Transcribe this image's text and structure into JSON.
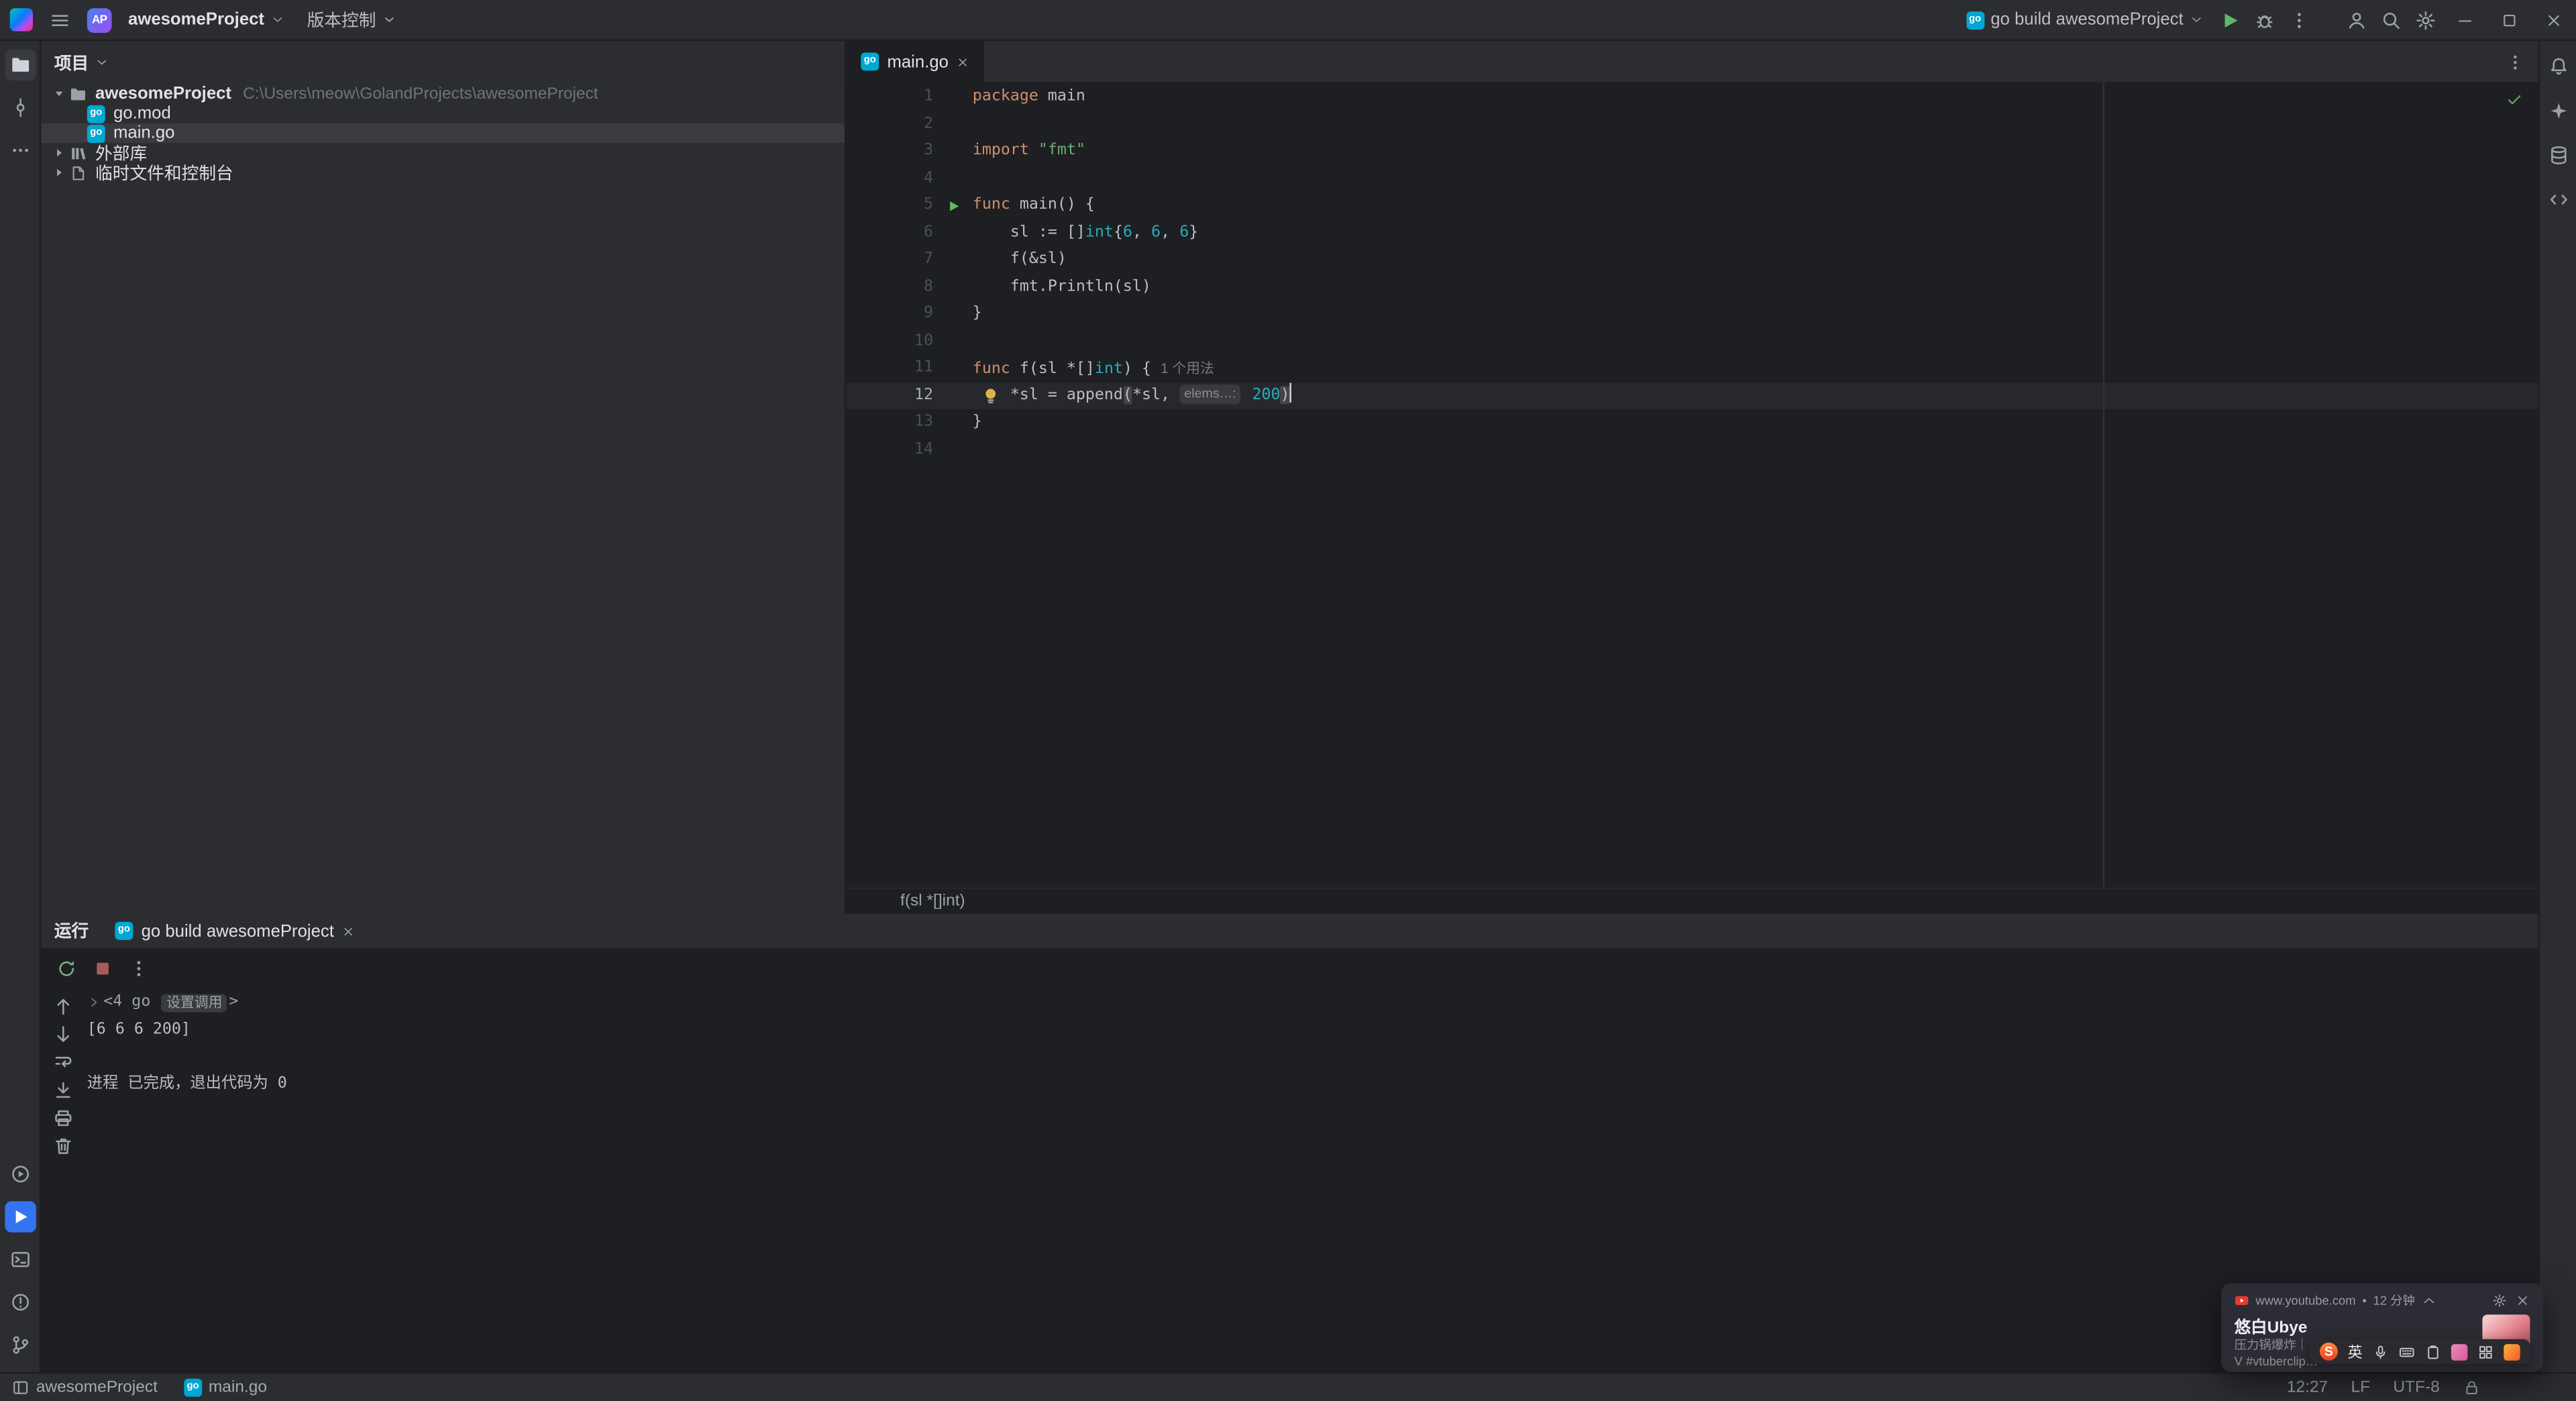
{
  "colors": {
    "accent": "#3574f0",
    "run_green": "#5fb865",
    "keyword": "#cf8e6d",
    "string": "#6aab73",
    "number": "#2aacb8",
    "editor_bg": "#1e1f22",
    "panel_bg": "#2b2d30"
  },
  "icons": {
    "go_badge": "go"
  },
  "titlebar": {
    "project_badge": "AP",
    "project_name": "awesomeProject",
    "vcs_label": "版本控制",
    "run_config_label": "go build awesomeProject"
  },
  "left_strip": {
    "top": [
      {
        "icon": "project-folder-icon",
        "active": true
      },
      {
        "icon": "commit-icon"
      },
      {
        "icon": "more-horizontal-icon"
      }
    ],
    "bottom": [
      {
        "icon": "services-icon"
      },
      {
        "icon": "run-tool-icon",
        "active": true,
        "accent": true
      },
      {
        "icon": "terminal-icon"
      },
      {
        "icon": "problems-icon"
      },
      {
        "icon": "git-branch-icon"
      }
    ]
  },
  "right_strip": {
    "icons": [
      "notifications-bell-icon",
      "ai-assistant-icon",
      "database-icon",
      "endpoints-icon"
    ]
  },
  "project": {
    "header": "项目",
    "items": [
      {
        "name": "awesomeProject",
        "path": "C:\\Users\\meow\\GolandProjects\\awesomeProject",
        "icon": "folder-icon",
        "level": 0,
        "expanded": true,
        "bold": true
      },
      {
        "name": "go.mod",
        "icon": "go-file-icon",
        "level": 1
      },
      {
        "name": "main.go",
        "icon": "go-file-icon",
        "level": 1,
        "selected": true
      },
      {
        "name": "外部库",
        "icon": "library-icon",
        "level": 0,
        "collapsed": true
      },
      {
        "name": "临时文件和控制台",
        "icon": "scratch-icon",
        "level": 0,
        "collapsed": true
      }
    ]
  },
  "editor": {
    "tab_title": "main.go",
    "breadcrumb": "f(sl *[]int)",
    "current_line": 12,
    "run_line": 5,
    "bulb_line": 12,
    "lines": [
      {
        "n": 1,
        "tokens": [
          [
            "kw",
            "package"
          ],
          [
            "pl",
            " main"
          ]
        ]
      },
      {
        "n": 2,
        "tokens": []
      },
      {
        "n": 3,
        "tokens": [
          [
            "kw",
            "import"
          ],
          [
            "pl",
            " "
          ],
          [
            "str",
            "\"fmt\""
          ]
        ]
      },
      {
        "n": 4,
        "tokens": []
      },
      {
        "n": 5,
        "tokens": [
          [
            "kw",
            "func"
          ],
          [
            "pl",
            " main() {"
          ]
        ]
      },
      {
        "n": 6,
        "tokens": [
          [
            "pl",
            "    sl := []"
          ],
          [
            "ty",
            "int"
          ],
          [
            "pl",
            "{"
          ],
          [
            "num",
            "6"
          ],
          [
            "pl",
            ", "
          ],
          [
            "num",
            "6"
          ],
          [
            "pl",
            ", "
          ],
          [
            "num",
            "6"
          ],
          [
            "pl",
            "}"
          ]
        ]
      },
      {
        "n": 7,
        "tokens": [
          [
            "pl",
            "    f(&sl)"
          ]
        ]
      },
      {
        "n": 8,
        "tokens": [
          [
            "pl",
            "    fmt.Println(sl)"
          ]
        ]
      },
      {
        "n": 9,
        "tokens": [
          [
            "pl",
            "}"
          ]
        ]
      },
      {
        "n": 10,
        "tokens": []
      },
      {
        "n": 11,
        "tokens": [
          [
            "kw",
            "func"
          ],
          [
            "pl",
            " f(sl *[]"
          ],
          [
            "ty",
            "int"
          ],
          [
            "pl",
            ") { "
          ],
          [
            "usage",
            "1 个用法"
          ]
        ]
      },
      {
        "n": 12,
        "tokens": [
          [
            "pl",
            "    *sl = append"
          ],
          [
            "brace",
            "("
          ],
          [
            "pl",
            "*sl, "
          ],
          [
            "chip",
            "elems…:"
          ],
          [
            "pl",
            " "
          ],
          [
            "num",
            "200"
          ],
          [
            "brace",
            ")"
          ],
          [
            "caret",
            ""
          ]
        ]
      },
      {
        "n": 13,
        "tokens": [
          [
            "pl",
            "}"
          ]
        ]
      },
      {
        "n": 14,
        "tokens": []
      }
    ]
  },
  "run_panel": {
    "title": "运行",
    "tab": "go build awesomeProject",
    "console": [
      {
        "kind": "fold",
        "pre": "<4 go ",
        "chip": "设置调用",
        "post": ">"
      },
      {
        "kind": "text",
        "text": "[6 6 6 200]"
      },
      {
        "kind": "text",
        "text": ""
      },
      {
        "kind": "text",
        "text": "进程 已完成，退出代码为 0"
      }
    ],
    "toolbar_icons": [
      "rerun-icon",
      "stop-icon",
      "more-vertical-icon"
    ],
    "gutter_icons": [
      "prev-occurrence-icon",
      "next-occurrence-icon",
      "soft-wrap-icon",
      "scroll-to-end-icon",
      "print-icon",
      "clear-all-icon"
    ]
  },
  "statusbar": {
    "left": [
      {
        "icon": "window-icon",
        "label": "awesomeProject"
      },
      {
        "icon": "go-file-icon",
        "label": "main.go"
      }
    ],
    "right": [
      {
        "name": "cursor-position",
        "label": "12:27"
      },
      {
        "name": "line-separator",
        "label": "LF"
      },
      {
        "name": "file-encoding",
        "label": "UTF-8"
      }
    ],
    "right_icons": [
      "readonly-lock-icon"
    ]
  },
  "toast": {
    "source": "www.youtube.com",
    "sep": "•",
    "time": "12 分钟",
    "title": "悠白Ubye",
    "body_line1": "压力锅爆炸｜…",
    "body_line2": "V #vtuberclip…"
  },
  "ime": {
    "logo": "S",
    "mode": "英"
  }
}
